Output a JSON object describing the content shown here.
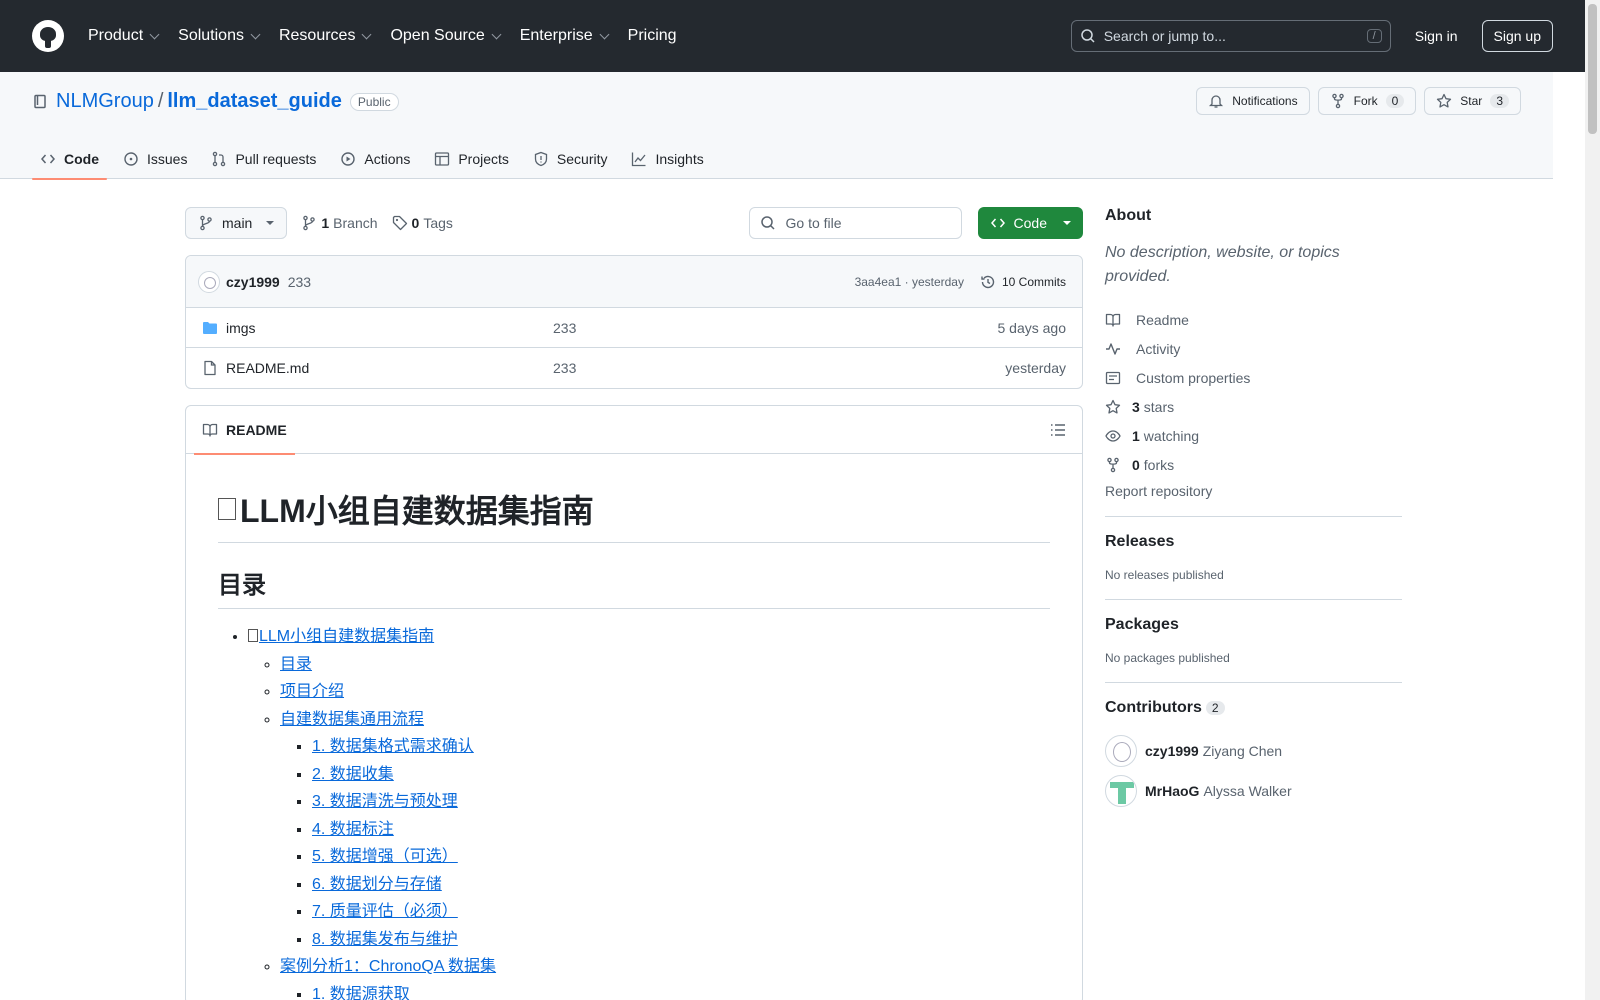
{
  "header": {
    "nav": [
      "Product",
      "Solutions",
      "Resources",
      "Open Source",
      "Enterprise",
      "Pricing"
    ],
    "search_placeholder": "Search or jump to...",
    "search_shortcut": "/",
    "sign_in": "Sign in",
    "sign_up": "Sign up"
  },
  "repo": {
    "owner": "NLMGroup",
    "separator": "/",
    "name": "llm_dataset_guide",
    "visibility": "Public",
    "notifications_label": "Notifications",
    "fork_label": "Fork",
    "fork_count": "0",
    "star_label": "Star",
    "star_count": "3",
    "tabs": [
      "Code",
      "Issues",
      "Pull requests",
      "Actions",
      "Projects",
      "Security",
      "Insights"
    ]
  },
  "file_nav": {
    "branch": "main",
    "branch_count": "1",
    "branch_label": "Branch",
    "tag_count": "0",
    "tag_label": "Tags",
    "goto_placeholder": "Go to file",
    "code_label": "Code"
  },
  "commit": {
    "author": "czy1999",
    "message": "233",
    "sha_time": "3aa4ea1 · yesterday",
    "commits_label": "10 Commits"
  },
  "files": [
    {
      "name": "imgs",
      "message": "233",
      "date": "5 days ago",
      "type": "folder"
    },
    {
      "name": "README.md",
      "message": "233",
      "date": "yesterday",
      "type": "file"
    }
  ],
  "readme": {
    "tab_label": "README",
    "h1": "LLM小组自建数据集指南",
    "h2": "目录",
    "toc": {
      "root": "LLM小组自建数据集指南",
      "l1": [
        "目录",
        "项目介绍",
        "自建数据集通用流程"
      ],
      "steps": [
        "1. 数据集格式需求确认",
        "2. 数据收集",
        "3. 数据清洗与预处理",
        "4. 数据标注",
        "5. 数据增强（可选）",
        "6. 数据划分与存储",
        "7. 质量评估（必须）",
        "8. 数据集发布与维护"
      ],
      "case1": "案例分析1：ChronoQA 数据集",
      "case1_steps": [
        "1. 数据源获取"
      ]
    }
  },
  "sidebar": {
    "about_title": "About",
    "description": "No description, website, or topics provided.",
    "items": [
      {
        "icon": "book-icon",
        "count": "",
        "label": "Readme"
      },
      {
        "icon": "pulse-icon",
        "count": "",
        "label": "Activity"
      },
      {
        "icon": "note-icon",
        "count": "",
        "label": "Custom properties"
      },
      {
        "icon": "star-icon",
        "count": "3",
        "label": "stars"
      },
      {
        "icon": "eye-icon",
        "count": "1",
        "label": "watching"
      },
      {
        "icon": "fork-icon",
        "count": "0",
        "label": "forks"
      }
    ],
    "report": "Report repository",
    "releases_title": "Releases",
    "releases_empty": "No releases published",
    "packages_title": "Packages",
    "packages_empty": "No packages published",
    "contributors_title": "Contributors",
    "contributors_count": "2",
    "contributors": [
      {
        "login": "czy1999",
        "name": "Ziyang Chen"
      },
      {
        "login": "MrHaoG",
        "name": "Alyssa Walker"
      }
    ]
  }
}
